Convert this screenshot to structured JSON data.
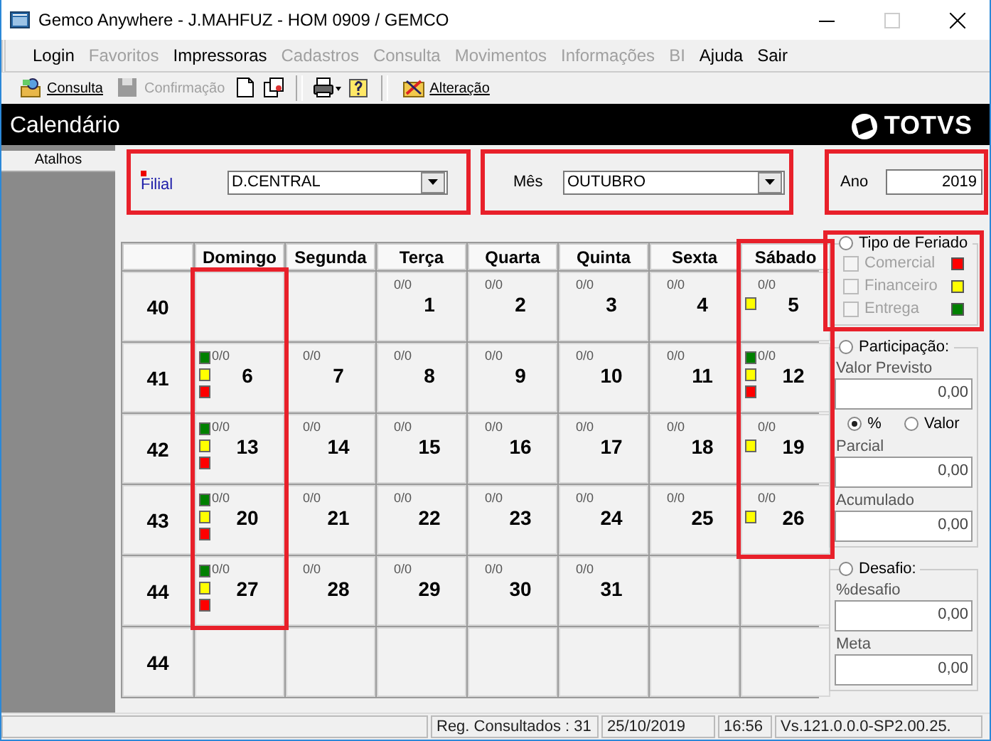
{
  "window": {
    "title": "Gemco Anywhere - J.MAHFUZ - HOM 0909 / GEMCO",
    "maximize_disabled": true
  },
  "menu": [
    {
      "label": "Login",
      "disabled": false
    },
    {
      "label": "Favoritos",
      "disabled": true
    },
    {
      "label": "Impressoras",
      "disabled": false
    },
    {
      "label": "Cadastros",
      "disabled": true
    },
    {
      "label": "Consulta",
      "disabled": true
    },
    {
      "label": "Movimentos",
      "disabled": true
    },
    {
      "label": "Informações",
      "disabled": true
    },
    {
      "label": "BI",
      "disabled": true
    },
    {
      "label": "Ajuda",
      "disabled": false
    },
    {
      "label": "Sair",
      "disabled": false
    }
  ],
  "toolbar": [
    {
      "kind": "search",
      "label": "Consulta",
      "disabled": false
    },
    {
      "kind": "save",
      "label": "Confirmação",
      "disabled": true
    },
    {
      "kind": "new"
    },
    {
      "kind": "copy"
    },
    {
      "kind": "separator"
    },
    {
      "kind": "print"
    },
    {
      "kind": "help"
    },
    {
      "kind": "separator"
    },
    {
      "kind": "edit",
      "label": "Alteração",
      "disabled": false
    }
  ],
  "header": {
    "title": "Calendário",
    "logo_text": "TOTVS"
  },
  "sidebar": {
    "title": "Atalhos"
  },
  "filters": [
    {
      "label": "Filial",
      "required": true,
      "kind": "select",
      "value": "D.CENTRAL",
      "highlighted": true
    },
    {
      "label": "Mês",
      "required": false,
      "kind": "select",
      "value": "OUTUBRO",
      "highlighted": true
    },
    {
      "label": "Ano",
      "required": false,
      "kind": "input",
      "value": "2019",
      "highlighted": true
    }
  ],
  "calendar": {
    "columns": [
      {
        "label": "Domingo",
        "highlighted": false
      },
      {
        "label": "Segunda",
        "highlighted": false
      },
      {
        "label": "Terça",
        "highlighted": false
      },
      {
        "label": "Quarta",
        "highlighted": false
      },
      {
        "label": "Quinta",
        "highlighted": false
      },
      {
        "label": "Sexta",
        "highlighted": false
      },
      {
        "label": "Sábado",
        "highlighted": true
      }
    ],
    "weeks": [
      {
        "number": "40",
        "days": [
          {
            "kind": "empty",
            "highlighted": true
          },
          {
            "kind": "empty",
            "highlighted": false
          },
          {
            "kind": "day",
            "day": "1",
            "count": "0/0",
            "comercial": false,
            "financeiro": false,
            "entrega": false,
            "highlighted": false
          },
          {
            "kind": "day",
            "day": "2",
            "count": "0/0",
            "comercial": false,
            "financeiro": false,
            "entrega": false,
            "highlighted": false
          },
          {
            "kind": "day",
            "day": "3",
            "count": "0/0",
            "comercial": false,
            "financeiro": false,
            "entrega": false,
            "highlighted": false
          },
          {
            "kind": "day",
            "day": "4",
            "count": "0/0",
            "comercial": false,
            "financeiro": false,
            "entrega": false,
            "highlighted": false
          },
          {
            "kind": "day",
            "day": "5",
            "count": "0/0",
            "comercial": false,
            "financeiro": true,
            "entrega": false,
            "highlighted": true
          }
        ]
      },
      {
        "number": "41",
        "days": [
          {
            "kind": "day",
            "day": "6",
            "count": "0/0",
            "comercial": true,
            "financeiro": true,
            "entrega": true,
            "highlighted": true
          },
          {
            "kind": "day",
            "day": "7",
            "count": "0/0",
            "comercial": false,
            "financeiro": false,
            "entrega": false,
            "highlighted": false
          },
          {
            "kind": "day",
            "day": "8",
            "count": "0/0",
            "comercial": false,
            "financeiro": false,
            "entrega": false,
            "highlighted": false
          },
          {
            "kind": "day",
            "day": "9",
            "count": "0/0",
            "comercial": false,
            "financeiro": false,
            "entrega": false,
            "highlighted": false
          },
          {
            "kind": "day",
            "day": "10",
            "count": "0/0",
            "comercial": false,
            "financeiro": false,
            "entrega": false,
            "highlighted": false
          },
          {
            "kind": "day",
            "day": "11",
            "count": "0/0",
            "comercial": false,
            "financeiro": false,
            "entrega": false,
            "highlighted": false
          },
          {
            "kind": "day",
            "day": "12",
            "count": "0/0",
            "comercial": true,
            "financeiro": true,
            "entrega": true,
            "highlighted": true
          }
        ]
      },
      {
        "number": "42",
        "days": [
          {
            "kind": "day",
            "day": "13",
            "count": "0/0",
            "comercial": true,
            "financeiro": true,
            "entrega": true,
            "highlighted": true
          },
          {
            "kind": "day",
            "day": "14",
            "count": "0/0",
            "comercial": false,
            "financeiro": false,
            "entrega": false,
            "highlighted": false
          },
          {
            "kind": "day",
            "day": "15",
            "count": "0/0",
            "comercial": false,
            "financeiro": false,
            "entrega": false,
            "highlighted": false
          },
          {
            "kind": "day",
            "day": "16",
            "count": "0/0",
            "comercial": false,
            "financeiro": false,
            "entrega": false,
            "highlighted": false
          },
          {
            "kind": "day",
            "day": "17",
            "count": "0/0",
            "comercial": false,
            "financeiro": false,
            "entrega": false,
            "highlighted": false
          },
          {
            "kind": "day",
            "day": "18",
            "count": "0/0",
            "comercial": false,
            "financeiro": false,
            "entrega": false,
            "highlighted": false
          },
          {
            "kind": "day",
            "day": "19",
            "count": "0/0",
            "comercial": false,
            "financeiro": true,
            "entrega": false,
            "highlighted": true
          }
        ]
      },
      {
        "number": "43",
        "days": [
          {
            "kind": "day",
            "day": "20",
            "count": "0/0",
            "comercial": true,
            "financeiro": true,
            "entrega": true,
            "highlighted": true
          },
          {
            "kind": "day",
            "day": "21",
            "count": "0/0",
            "comercial": false,
            "financeiro": false,
            "entrega": false,
            "highlighted": false
          },
          {
            "kind": "day",
            "day": "22",
            "count": "0/0",
            "comercial": false,
            "financeiro": false,
            "entrega": false,
            "highlighted": false
          },
          {
            "kind": "day",
            "day": "23",
            "count": "0/0",
            "comercial": false,
            "financeiro": false,
            "entrega": false,
            "highlighted": false
          },
          {
            "kind": "day",
            "day": "24",
            "count": "0/0",
            "comercial": false,
            "financeiro": false,
            "entrega": false,
            "highlighted": false
          },
          {
            "kind": "day",
            "day": "25",
            "count": "0/0",
            "comercial": false,
            "financeiro": false,
            "entrega": false,
            "highlighted": false
          },
          {
            "kind": "day",
            "day": "26",
            "count": "0/0",
            "comercial": false,
            "financeiro": true,
            "entrega": false,
            "highlighted": true
          }
        ]
      },
      {
        "number": "44",
        "days": [
          {
            "kind": "day",
            "day": "27",
            "count": "0/0",
            "comercial": true,
            "financeiro": true,
            "entrega": true,
            "highlighted": true
          },
          {
            "kind": "day",
            "day": "28",
            "count": "0/0",
            "comercial": false,
            "financeiro": false,
            "entrega": false,
            "highlighted": false
          },
          {
            "kind": "day",
            "day": "29",
            "count": "0/0",
            "comercial": false,
            "financeiro": false,
            "entrega": false,
            "highlighted": false
          },
          {
            "kind": "day",
            "day": "30",
            "count": "0/0",
            "comercial": false,
            "financeiro": false,
            "entrega": false,
            "highlighted": false
          },
          {
            "kind": "day",
            "day": "31",
            "count": "0/0",
            "comercial": false,
            "financeiro": false,
            "entrega": false,
            "highlighted": false
          },
          {
            "kind": "empty",
            "highlighted": false
          },
          {
            "kind": "empty",
            "highlighted": false
          }
        ]
      },
      {
        "number": "44",
        "days": [
          {
            "kind": "empty",
            "highlighted": false
          },
          {
            "kind": "empty",
            "highlighted": false
          },
          {
            "kind": "empty",
            "highlighted": false
          },
          {
            "kind": "empty",
            "highlighted": false
          },
          {
            "kind": "empty",
            "highlighted": false
          },
          {
            "kind": "empty",
            "highlighted": false
          },
          {
            "kind": "empty",
            "highlighted": false
          }
        ]
      }
    ]
  },
  "side_panel": [
    {
      "kind": "legend",
      "label": "Tipo de Feriado",
      "selected": false,
      "highlighted": true,
      "items": [
        {
          "label": "Comercial",
          "checked": false,
          "disabled": true,
          "color": "#ff0000"
        },
        {
          "label": "Financeiro",
          "checked": false,
          "disabled": true,
          "color": "#ffff00"
        },
        {
          "label": "Entrega",
          "checked": false,
          "disabled": true,
          "color": "#008000"
        }
      ]
    },
    {
      "kind": "form",
      "label": "Participação:",
      "selected": false,
      "highlighted": false,
      "items": [
        {
          "kind": "field",
          "label": "Valor Previsto",
          "value": "0,00"
        },
        {
          "kind": "radios",
          "options": [
            {
              "label": "%",
              "selected": true
            },
            {
              "label": "Valor",
              "selected": false
            }
          ]
        },
        {
          "kind": "field",
          "label": "Parcial",
          "value": "0,00"
        },
        {
          "kind": "field",
          "label": "Acumulado",
          "value": "0,00"
        }
      ]
    },
    {
      "kind": "form",
      "label": "Desafio:",
      "selected": false,
      "highlighted": false,
      "items": [
        {
          "kind": "field",
          "label": "%desafio",
          "value": "0,00"
        },
        {
          "kind": "field",
          "label": "Meta",
          "value": "0,00"
        }
      ]
    }
  ],
  "status_bar": [
    "Reg. Consultados : 31",
    "25/10/2019",
    "16:56",
    "Vs.121.0.0.0-SP2.00.25."
  ]
}
